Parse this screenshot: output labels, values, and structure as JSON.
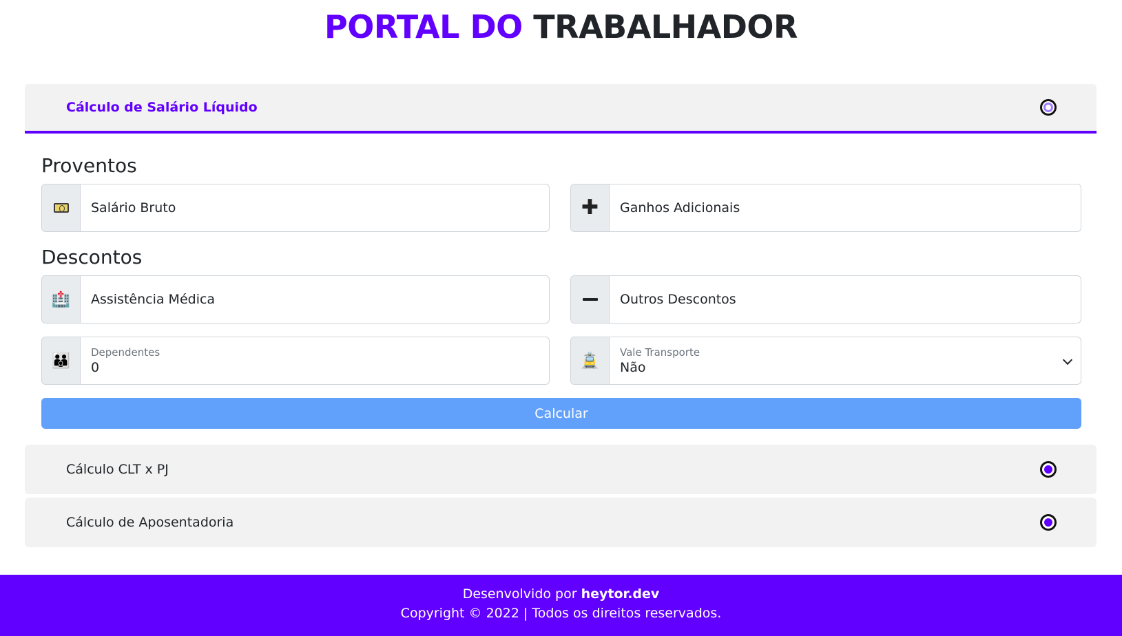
{
  "header": {
    "title_accent": "PORTAL DO",
    "title_rest": "TRABALHADOR"
  },
  "accordion": {
    "item1": "Cálculo de Salário Líquido",
    "item2": "Cálculo CLT x PJ",
    "item3": "Cálculo de Aposentadoria"
  },
  "form": {
    "proventos_title": "Proventos",
    "descontos_title": "Descontos",
    "salario_bruto_placeholder": "Salário Bruto",
    "ganhos_adicionais_placeholder": "Ganhos Adicionais",
    "assistencia_medica_placeholder": "Assistência Médica",
    "outros_descontos_placeholder": "Outros Descontos",
    "dependentes_label": "Dependentes",
    "dependentes_value": "0",
    "vale_transporte_label": "Vale Transporte",
    "vale_transporte_value": "Não",
    "calcular_label": "Calcular"
  },
  "footer": {
    "line1_prefix": "Desenvolvido por",
    "line1_author": "heytor.dev",
    "line2": "Copyright © 2022 | Todos os direitos reservados."
  },
  "colors": {
    "accent": "#6200ff",
    "button": "#62a1fb",
    "panel": "#f2f2f2"
  },
  "icons": {
    "salario": "money-icon",
    "ganhos": "plus-icon",
    "assistencia": "hospital-icon",
    "descontos": "minus-icon",
    "dependentes": "family-icon",
    "transporte": "tram-icon"
  }
}
